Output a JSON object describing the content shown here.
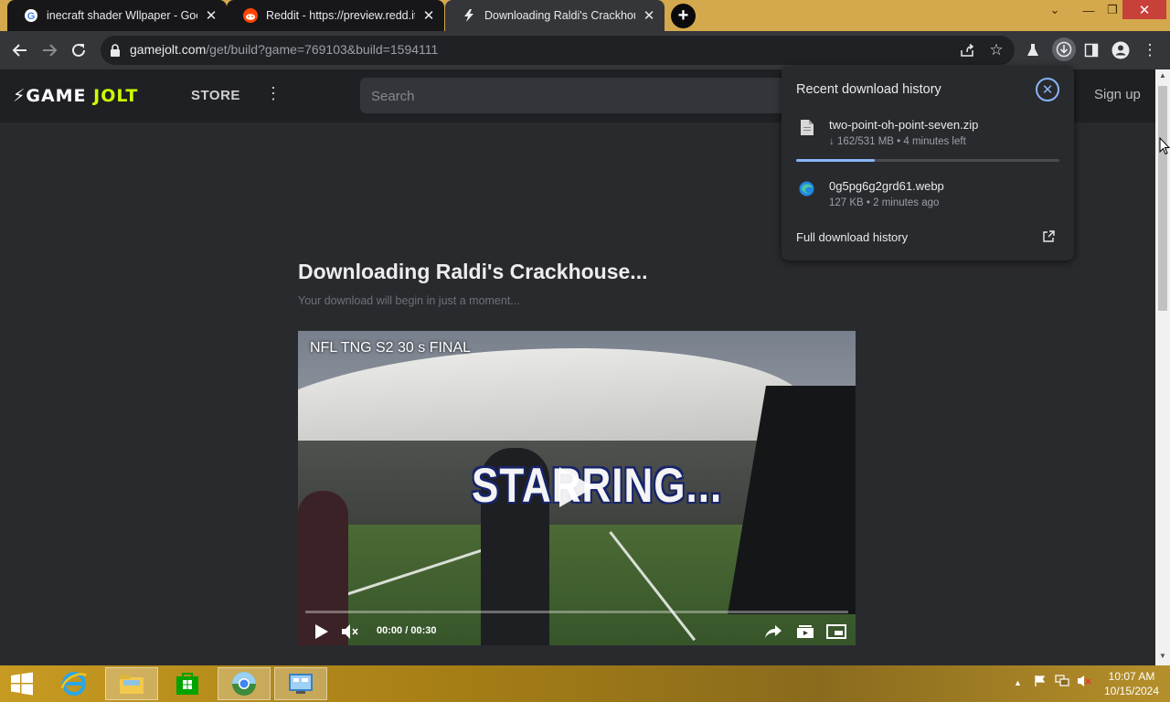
{
  "browser": {
    "tabs": [
      {
        "title": "inecraft shader Wllpaper - Goog",
        "favicon": "google-icon"
      },
      {
        "title": "Reddit - https://preview.redd.it/",
        "favicon": "reddit-icon"
      },
      {
        "title": "Downloading Raldi's Crackhouse",
        "favicon": "gamejolt-icon",
        "active": true
      }
    ],
    "url_host": "gamejolt.com",
    "url_path": "/get/build?game=769103&build=1594111"
  },
  "site": {
    "logo_left": "GAME",
    "logo_right": "JOLT",
    "store_label": "STORE",
    "search_placeholder": "Search",
    "signup_label": "Sign up",
    "download_title": "Downloading Raldi's Crackhouse...",
    "download_subtitle": "Your download will begin in just a moment..."
  },
  "video": {
    "title": "NFL TNG S2 30 s FINAL",
    "overlay_text": "STARRING...",
    "current_time": "00:00",
    "separator": "/",
    "duration": "00:30",
    "progress": 0
  },
  "downloads": {
    "heading": "Recent download history",
    "items": [
      {
        "name": "two-point-oh-point-seven.zip",
        "meta": "↓ 162/531 MB • 4 minutes left",
        "progress": 0.3,
        "icon": "file-icon"
      },
      {
        "name": "0g5pg6g2grd61.webp",
        "meta": "127 KB • 2 minutes ago",
        "icon": "edge-icon"
      }
    ],
    "full_history_label": "Full download history"
  },
  "taskbar": {
    "time": "10:07 AM",
    "date": "10/15/2024"
  },
  "colors": {
    "accent_blue": "#8ab4f8",
    "gamejolt_green": "#ccff00",
    "taskbar_gold": "#c79a22"
  }
}
